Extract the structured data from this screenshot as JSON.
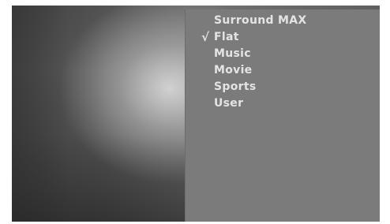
{
  "menu": {
    "items": [
      {
        "label": "Surround MAX",
        "checked": false
      },
      {
        "label": "Flat",
        "checked": true
      },
      {
        "label": "Music",
        "checked": false
      },
      {
        "label": "Movie",
        "checked": false
      },
      {
        "label": "Sports",
        "checked": false
      },
      {
        "label": "User",
        "checked": false
      }
    ],
    "check_glyph": "√"
  },
  "colors": {
    "panel": "#7b7b7b",
    "text": "#e4e4e4"
  }
}
